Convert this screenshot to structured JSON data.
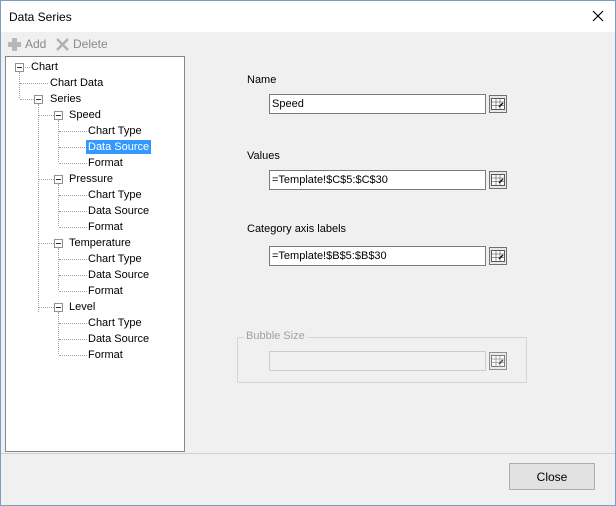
{
  "window": {
    "title": "Data Series"
  },
  "toolbar": {
    "add_label": "Add",
    "delete_label": "Delete"
  },
  "tree": {
    "root": "Chart",
    "chart_data": "Chart Data",
    "series_label": "Series",
    "series": [
      {
        "name": "Speed",
        "children": [
          "Chart Type",
          "Data Source",
          "Format"
        ]
      },
      {
        "name": "Pressure",
        "children": [
          "Chart Type",
          "Data Source",
          "Format"
        ]
      },
      {
        "name": "Temperature",
        "children": [
          "Chart Type",
          "Data Source",
          "Format"
        ]
      },
      {
        "name": "Level",
        "children": [
          "Chart Type",
          "Data Source",
          "Format"
        ]
      }
    ]
  },
  "form": {
    "name_label": "Name",
    "name_value": "Speed",
    "values_label": "Values",
    "values_value": "=Template!$C$5:$C$30",
    "category_label": "Category axis labels",
    "category_value": "=Template!$B$5:$B$30",
    "bubble_label": "Bubble Size",
    "bubble_value": ""
  },
  "footer": {
    "close_label": "Close"
  },
  "colors": {
    "selection": "#3399ff",
    "window_border": "#7a9cc5",
    "background": "#f0f0f0"
  },
  "icons": {
    "add": "plus-icon",
    "delete": "x-icon",
    "range_picker": "range-select-icon",
    "close": "close-icon"
  }
}
